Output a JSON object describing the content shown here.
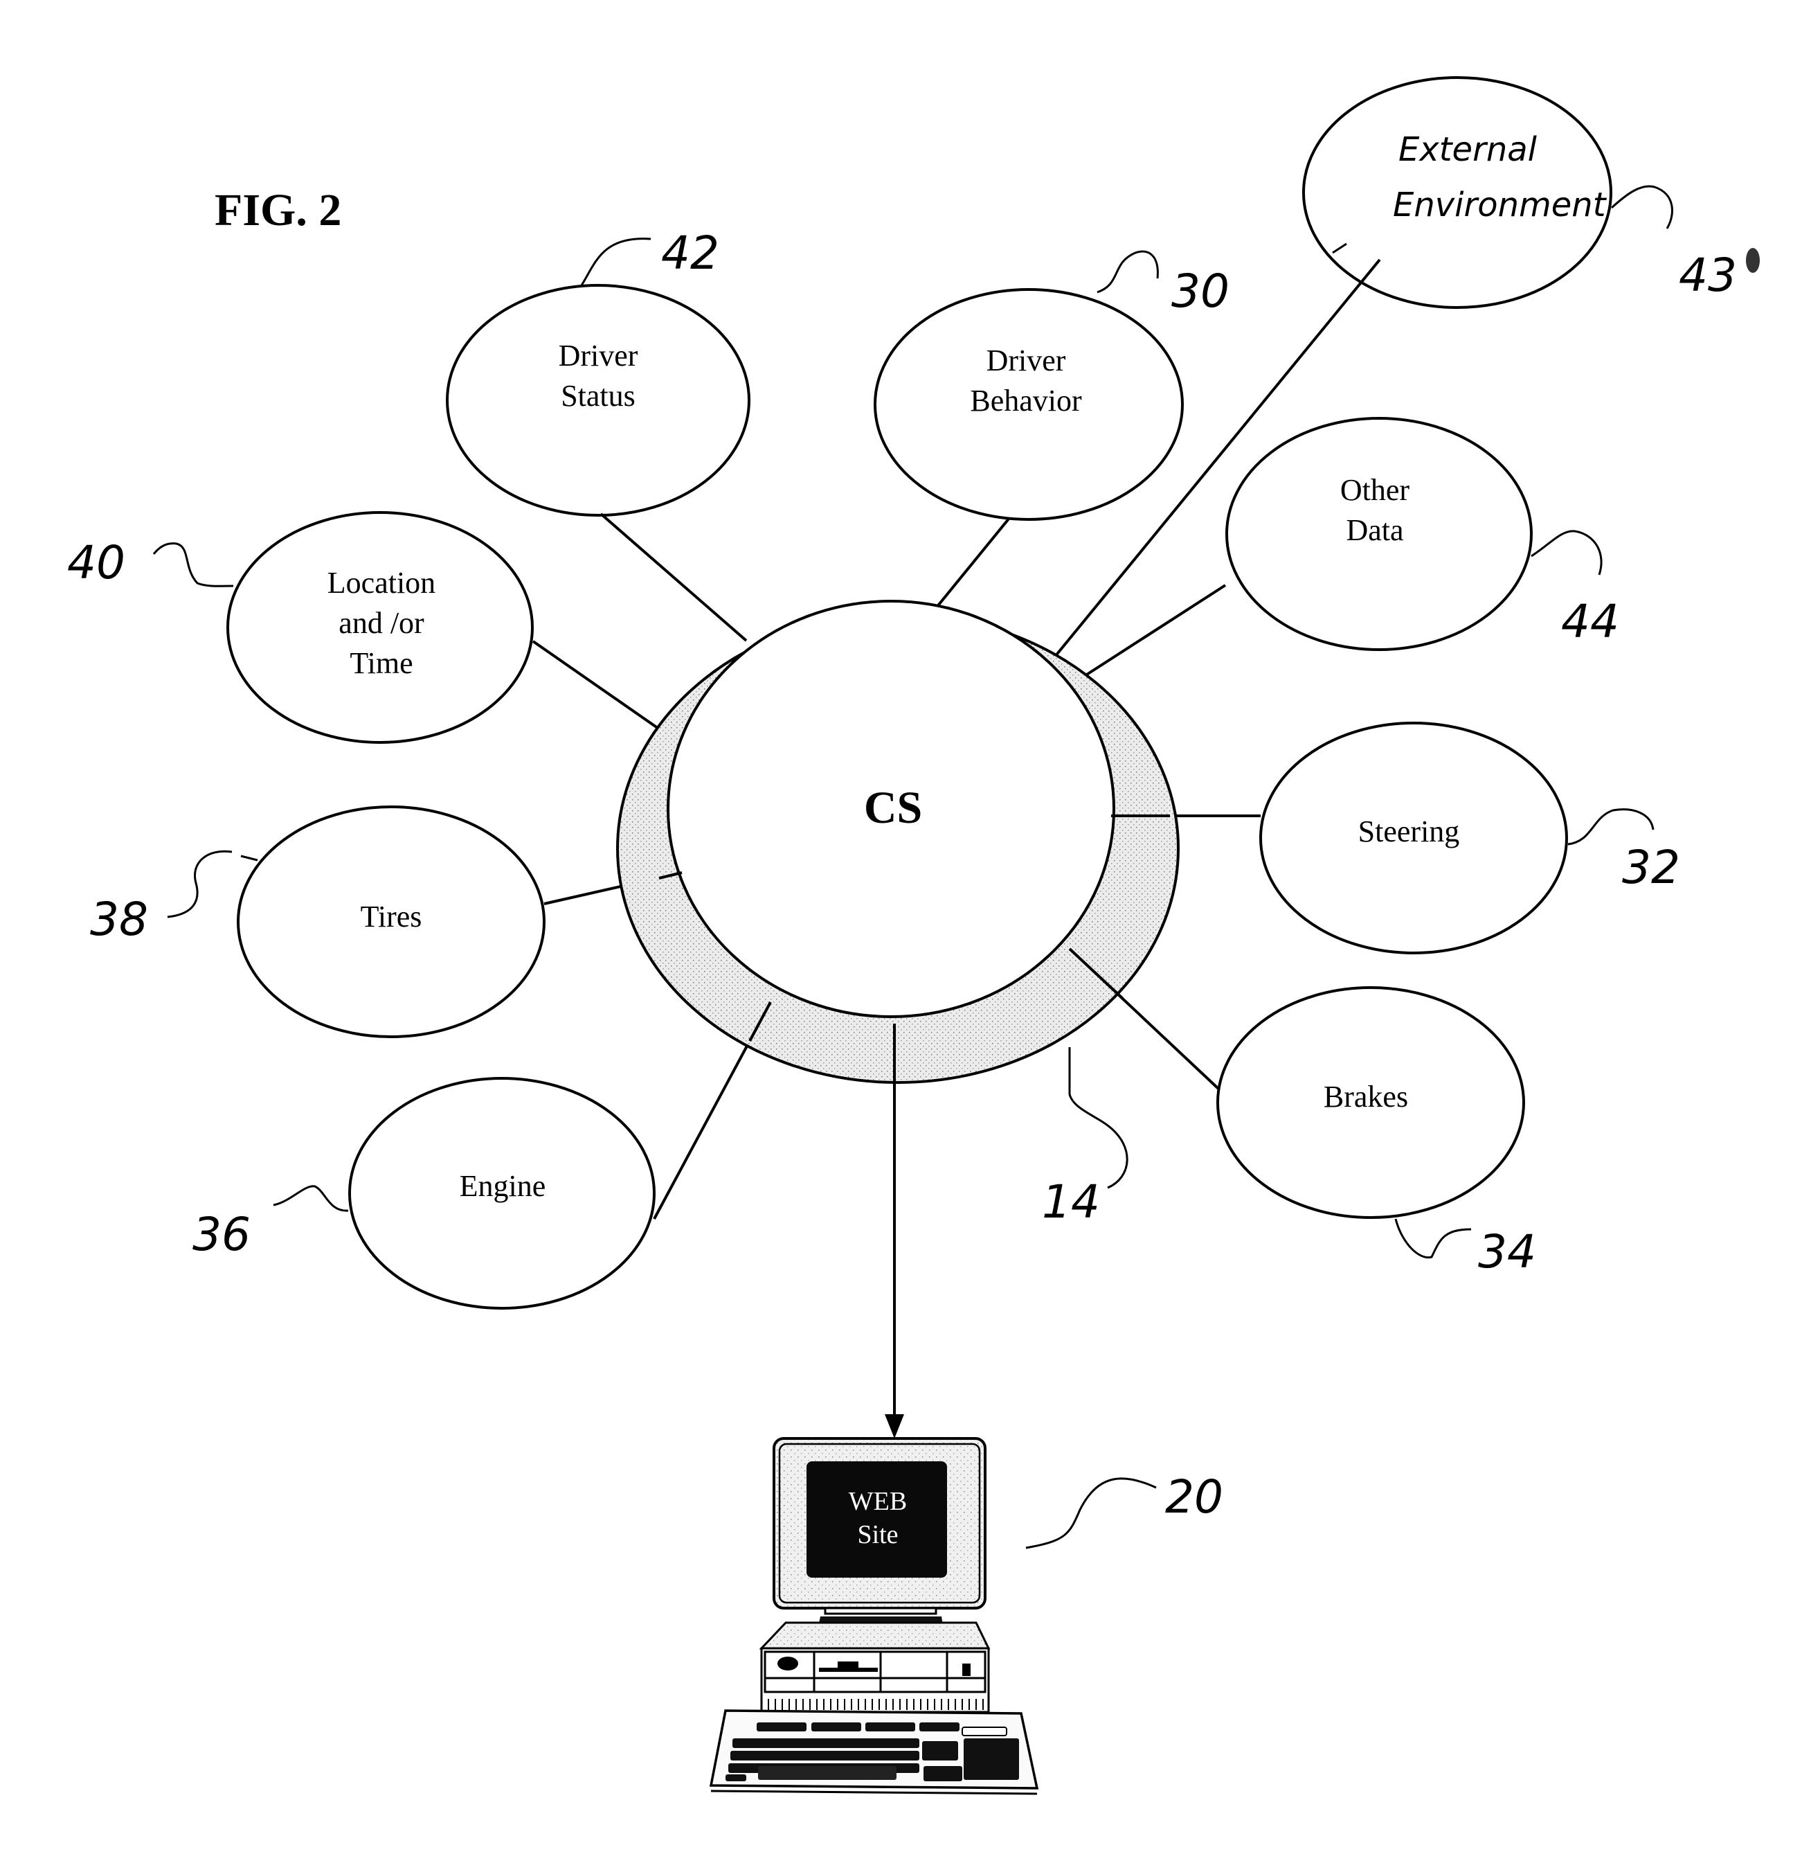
{
  "figure": {
    "title": "FIG. 2"
  },
  "central": {
    "label": "CS",
    "ring_ref": "14"
  },
  "nodes": [
    {
      "id": "driver-status",
      "lines": [
        "Driver",
        "Status"
      ],
      "ref": "42"
    },
    {
      "id": "driver-behavior",
      "lines": [
        "Driver",
        "Behavior"
      ],
      "ref": "30"
    },
    {
      "id": "external-environment",
      "lines": [
        "External",
        "Environment"
      ],
      "ref": "43",
      "handwritten": true
    },
    {
      "id": "other-data",
      "lines": [
        "Other",
        "Data"
      ],
      "ref": "44"
    },
    {
      "id": "location-time",
      "lines": [
        "Location",
        "and /or",
        "Time"
      ],
      "ref": "40"
    },
    {
      "id": "tires",
      "lines": [
        "Tires"
      ],
      "ref": "38"
    },
    {
      "id": "steering",
      "lines": [
        "Steering"
      ],
      "ref": "32"
    },
    {
      "id": "brakes",
      "lines": [
        "Brakes"
      ],
      "ref": "34"
    },
    {
      "id": "engine",
      "lines": [
        "Engine"
      ],
      "ref": "36"
    }
  ],
  "computer": {
    "screen_lines": [
      "WEB",
      "Site"
    ],
    "ref": "20"
  },
  "colors": {
    "ink": "#000000",
    "paper": "#ffffff",
    "ring_fill": "#e4e4e4",
    "screen": "#0a0a0a"
  }
}
